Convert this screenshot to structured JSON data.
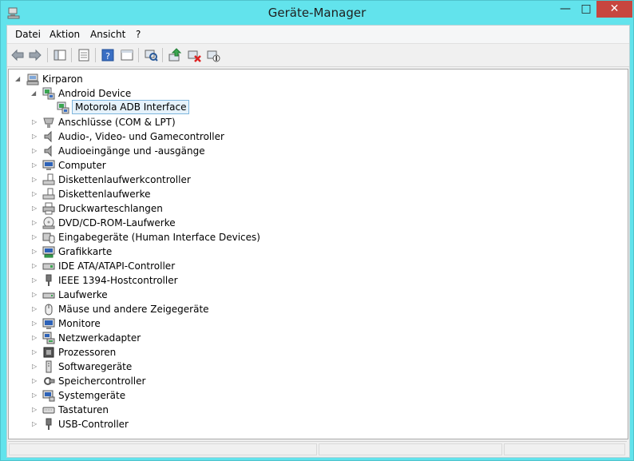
{
  "window": {
    "title": "Geräte-Manager",
    "minimize": "—",
    "maximize": "□",
    "close": "✕"
  },
  "menu": [
    "Datei",
    "Aktion",
    "Ansicht",
    "?"
  ],
  "toolbar": {
    "buttons": [
      "back-icon",
      "forward-icon",
      "show-hide-console-tree-icon",
      "properties-icon",
      "help-icon",
      "action-pane-icon",
      "scan-hardware-icon",
      "update-driver-icon",
      "uninstall-icon",
      "disable-icon"
    ]
  },
  "tree": {
    "root": "Kirparon",
    "android": "Android Device",
    "android_child": "Motorola ADB Interface",
    "categories": [
      "Anschlüsse (COM & LPT)",
      "Audio-, Video- und Gamecontroller",
      "Audioeingänge und -ausgänge",
      "Computer",
      "Diskettenlaufwerkcontroller",
      "Diskettenlaufwerke",
      "Druckwarteschlangen",
      "DVD/CD-ROM-Laufwerke",
      "Eingabegeräte (Human Interface Devices)",
      "Grafikkarte",
      "IDE ATA/ATAPI-Controller",
      "IEEE 1394-Hostcontroller",
      "Laufwerke",
      "Mäuse und andere Zeigegeräte",
      "Monitore",
      "Netzwerkadapter",
      "Prozessoren",
      "Softwaregeräte",
      "Speichercontroller",
      "Systemgeräte",
      "Tastaturen",
      "USB-Controller"
    ]
  }
}
